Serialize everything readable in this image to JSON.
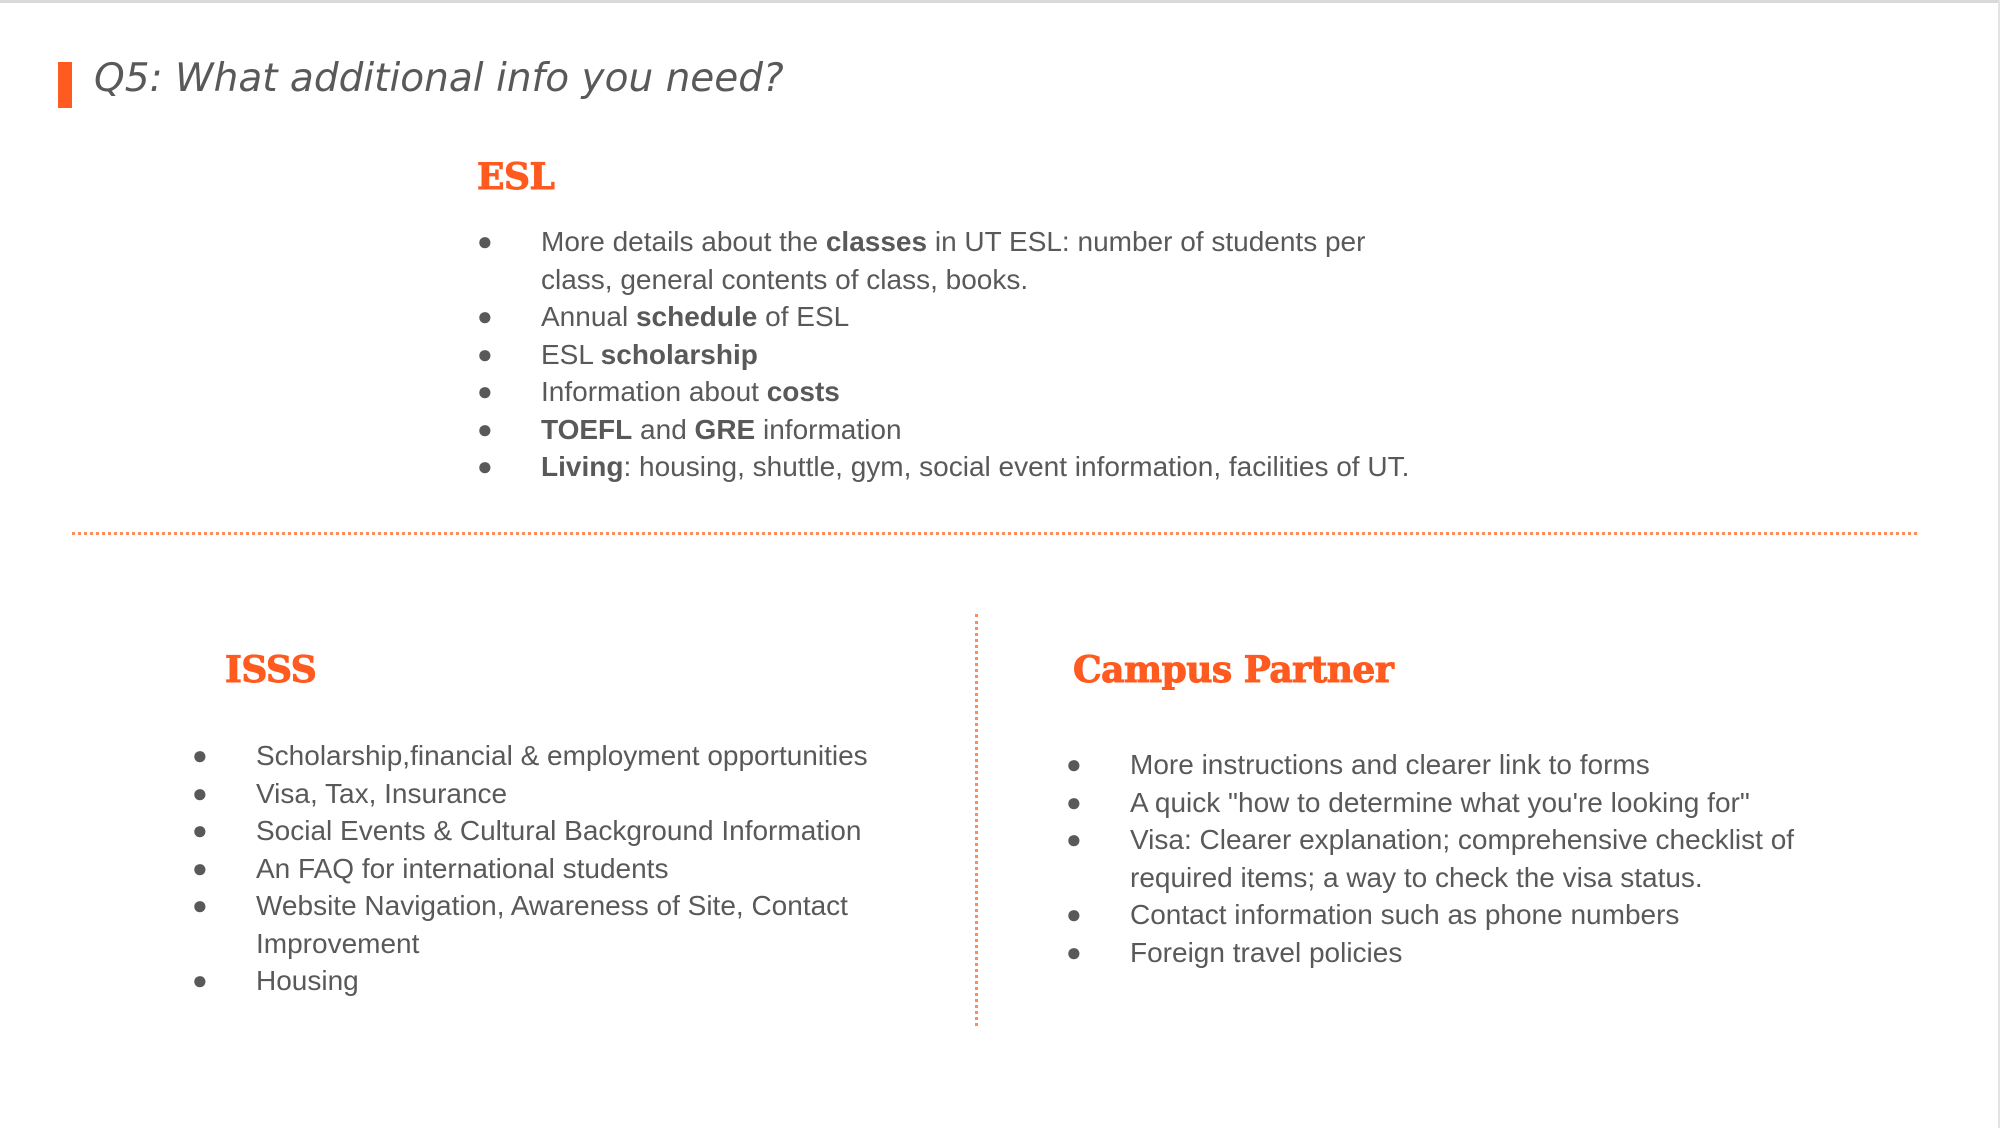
{
  "slide": {
    "title": "Q5: What additional info you need?"
  },
  "esl": {
    "heading": "ESL",
    "items": [
      {
        "parts": [
          {
            "text": "More details about the ",
            "bold": false
          },
          {
            "text": "classes",
            "bold": true
          },
          {
            "text": " in UT ESL: number of students per class, general contents of class, books.",
            "bold": false
          }
        ]
      },
      {
        "parts": [
          {
            "text": "Annual ",
            "bold": false
          },
          {
            "text": "schedule",
            "bold": true
          },
          {
            "text": " of ESL",
            "bold": false
          }
        ]
      },
      {
        "parts": [
          {
            "text": "ESL ",
            "bold": false
          },
          {
            "text": "scholarship",
            "bold": true
          }
        ]
      },
      {
        "parts": [
          {
            "text": "Information about ",
            "bold": false
          },
          {
            "text": "costs",
            "bold": true
          }
        ]
      },
      {
        "parts": [
          {
            "text": "TOEFL",
            "bold": true
          },
          {
            "text": " and ",
            "bold": false
          },
          {
            "text": "GRE",
            "bold": true
          },
          {
            "text": " information",
            "bold": false
          }
        ]
      },
      {
        "parts": [
          {
            "text": "Living",
            "bold": true
          },
          {
            "text": ": housing, shuttle, gym, social event information, facilities of UT.",
            "bold": false
          }
        ]
      }
    ]
  },
  "isss": {
    "heading": "ISSS",
    "items": [
      {
        "parts": [
          {
            "text": "Scholarship,financial & employment opportunities",
            "bold": false
          }
        ]
      },
      {
        "parts": [
          {
            "text": "Visa, Tax, Insurance",
            "bold": false
          }
        ]
      },
      {
        "parts": [
          {
            "text": "Social Events & Cultural Background Information",
            "bold": false
          }
        ]
      },
      {
        "parts": [
          {
            "text": "An FAQ for international students",
            "bold": false
          }
        ]
      },
      {
        "parts": [
          {
            "text": "Website Navigation, Awareness of Site, Contact Improvement",
            "bold": false
          }
        ]
      },
      {
        "parts": [
          {
            "text": "Housing",
            "bold": false
          }
        ]
      }
    ]
  },
  "campus_partner": {
    "heading": "Campus Partner",
    "items": [
      {
        "parts": [
          {
            "text": "More instructions and clearer link to forms",
            "bold": false
          }
        ]
      },
      {
        "parts": [
          {
            "text": "A quick \"how to determine what you're looking for\"",
            "bold": false
          }
        ]
      },
      {
        "parts": [
          {
            "text": "Visa: Clearer explanation; comprehensive checklist of required items; a way to check the visa status.",
            "bold": false
          }
        ]
      },
      {
        "parts": [
          {
            "text": "Contact information such as phone numbers",
            "bold": false
          }
        ]
      },
      {
        "parts": [
          {
            "text": "Foreign travel policies",
            "bold": false
          }
        ]
      }
    ]
  },
  "colors": {
    "accent": "#ff5a1f",
    "body_text": "#595959",
    "divider": "#ff8a5c"
  },
  "icons": {
    "bullet": "bullet-dot-icon"
  }
}
